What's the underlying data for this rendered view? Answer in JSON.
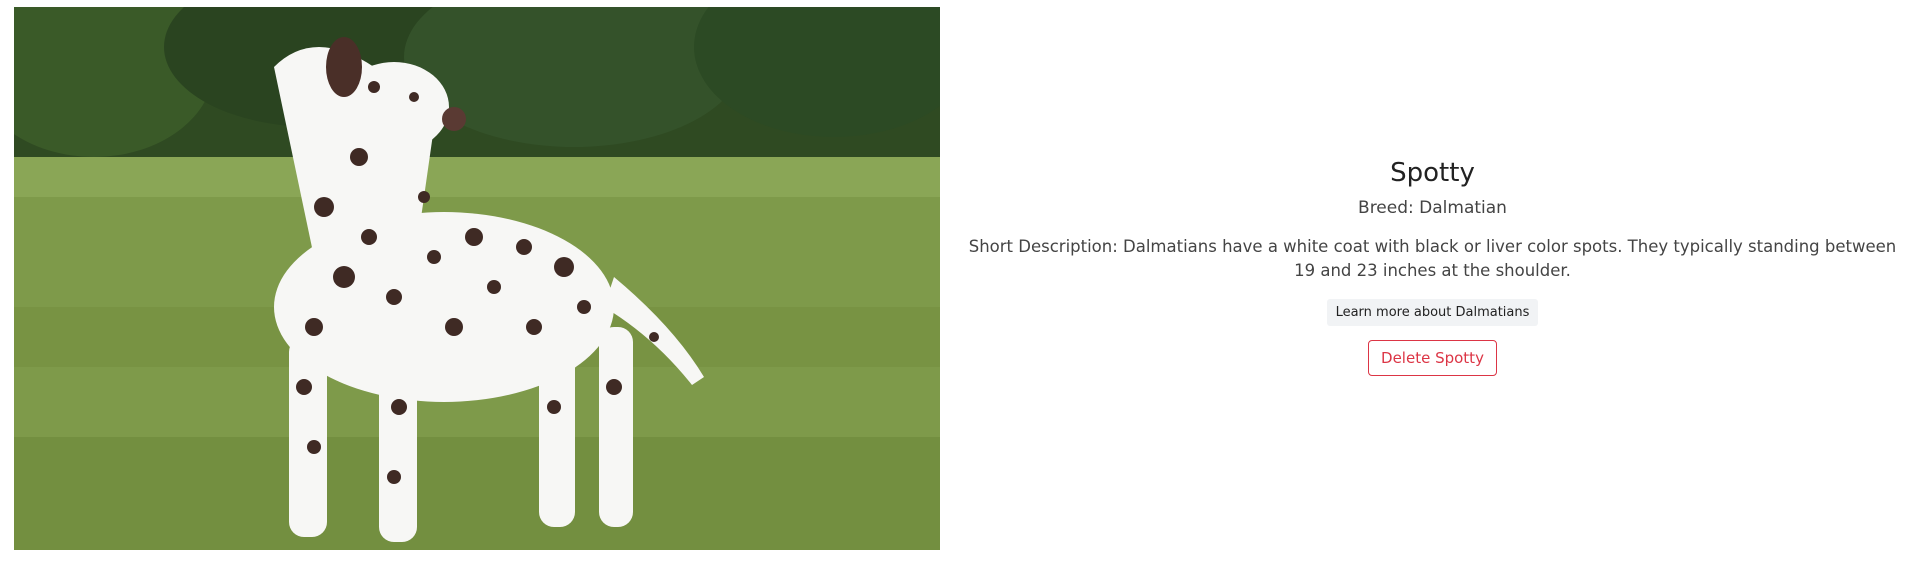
{
  "dog": {
    "name": "Spotty",
    "breed": "Breed: Dalmatian",
    "description": "Short Description: Dalmatians have a white coat with black or liver color spots. They typically standing between 19 and 23 inches at the shoulder.",
    "learn_more_label": "Learn more about Dalmatians",
    "delete_label": "Delete Spotty",
    "photo_alt": "Dalmatian dog standing in a grassy field"
  },
  "colors": {
    "delete_accent": "#dc3545",
    "learn_button_bg": "#f1f3f5",
    "text": "#444444"
  }
}
